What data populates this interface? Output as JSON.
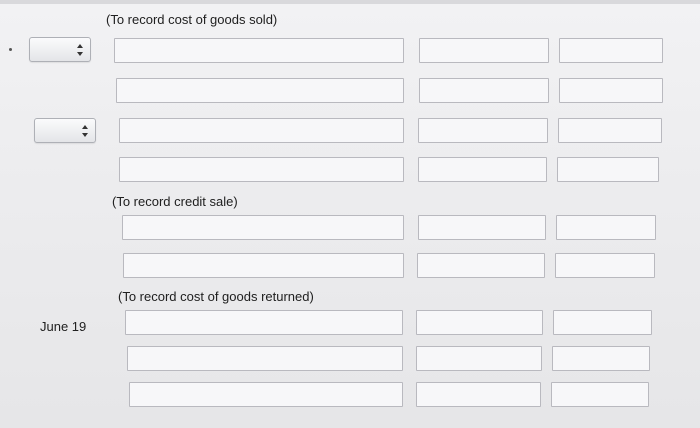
{
  "notes": {
    "cogs_sold": "(To record cost of goods sold)",
    "credit_sale": "(To record credit sale)",
    "cogs_returned": "(To record cost of goods returned)"
  },
  "dates": {
    "june19": "June 19"
  },
  "selects": [
    {
      "value": ""
    },
    {
      "value": ""
    }
  ],
  "rows": [
    {
      "account": "",
      "debit": "",
      "credit": ""
    },
    {
      "account": "",
      "debit": "",
      "credit": ""
    },
    {
      "account": "",
      "debit": "",
      "credit": ""
    },
    {
      "account": "",
      "debit": "",
      "credit": ""
    },
    {
      "account": "",
      "debit": "",
      "credit": ""
    },
    {
      "account": "",
      "debit": "",
      "credit": ""
    },
    {
      "account": "",
      "debit": "",
      "credit": ""
    },
    {
      "account": "",
      "debit": "",
      "credit": ""
    },
    {
      "account": "",
      "debit": "",
      "credit": ""
    }
  ]
}
